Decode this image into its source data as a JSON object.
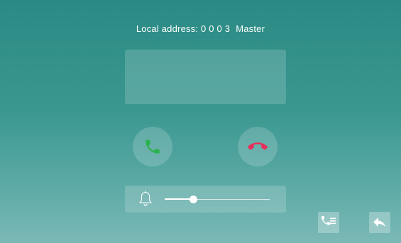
{
  "header": {
    "address_label": "Local address:",
    "address_value": "0 0 0 3",
    "role": "Master"
  },
  "buttons": {
    "answer_icon": "phone-answer-icon",
    "hangup_icon": "phone-hangup-icon",
    "call_list_icon": "phone-list-icon",
    "back_icon": "back-arrow-icon"
  },
  "volume": {
    "icon": "bell-icon",
    "level": 0.27
  },
  "colors": {
    "answer": "#2bb24c",
    "hangup": "#e8305a",
    "background_top": "#2b8a84",
    "background_bottom": "#7ab9b6"
  }
}
